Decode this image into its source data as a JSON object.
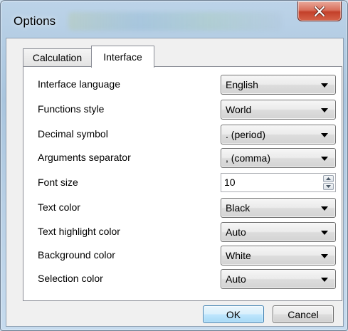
{
  "window": {
    "title": "Options",
    "close_icon": "close-x-icon"
  },
  "tabs": [
    {
      "label": "Calculation",
      "active": false
    },
    {
      "label": "Interface",
      "active": true
    }
  ],
  "settings": [
    {
      "label": "Interface language",
      "control": "select",
      "value": "English"
    },
    {
      "label": "Functions style",
      "control": "select",
      "value": "World"
    },
    {
      "label": "Decimal symbol",
      "control": "select",
      "value": ". (period)"
    },
    {
      "label": "Arguments separator",
      "control": "select",
      "value": ", (comma)"
    },
    {
      "label": "Font size",
      "control": "spin",
      "value": "10"
    },
    {
      "label": "Text color",
      "control": "select",
      "value": "Black"
    },
    {
      "label": "Text highlight color",
      "control": "select",
      "value": "Auto"
    },
    {
      "label": "Background color",
      "control": "select",
      "value": "White"
    },
    {
      "label": "Selection color",
      "control": "select",
      "value": "Auto"
    }
  ],
  "buttons": {
    "ok": "OK",
    "cancel": "Cancel"
  },
  "colors": {
    "close_button": "#c3402a",
    "default_button_border": "#3c7fb1",
    "window_frame": "#a9c5de"
  }
}
